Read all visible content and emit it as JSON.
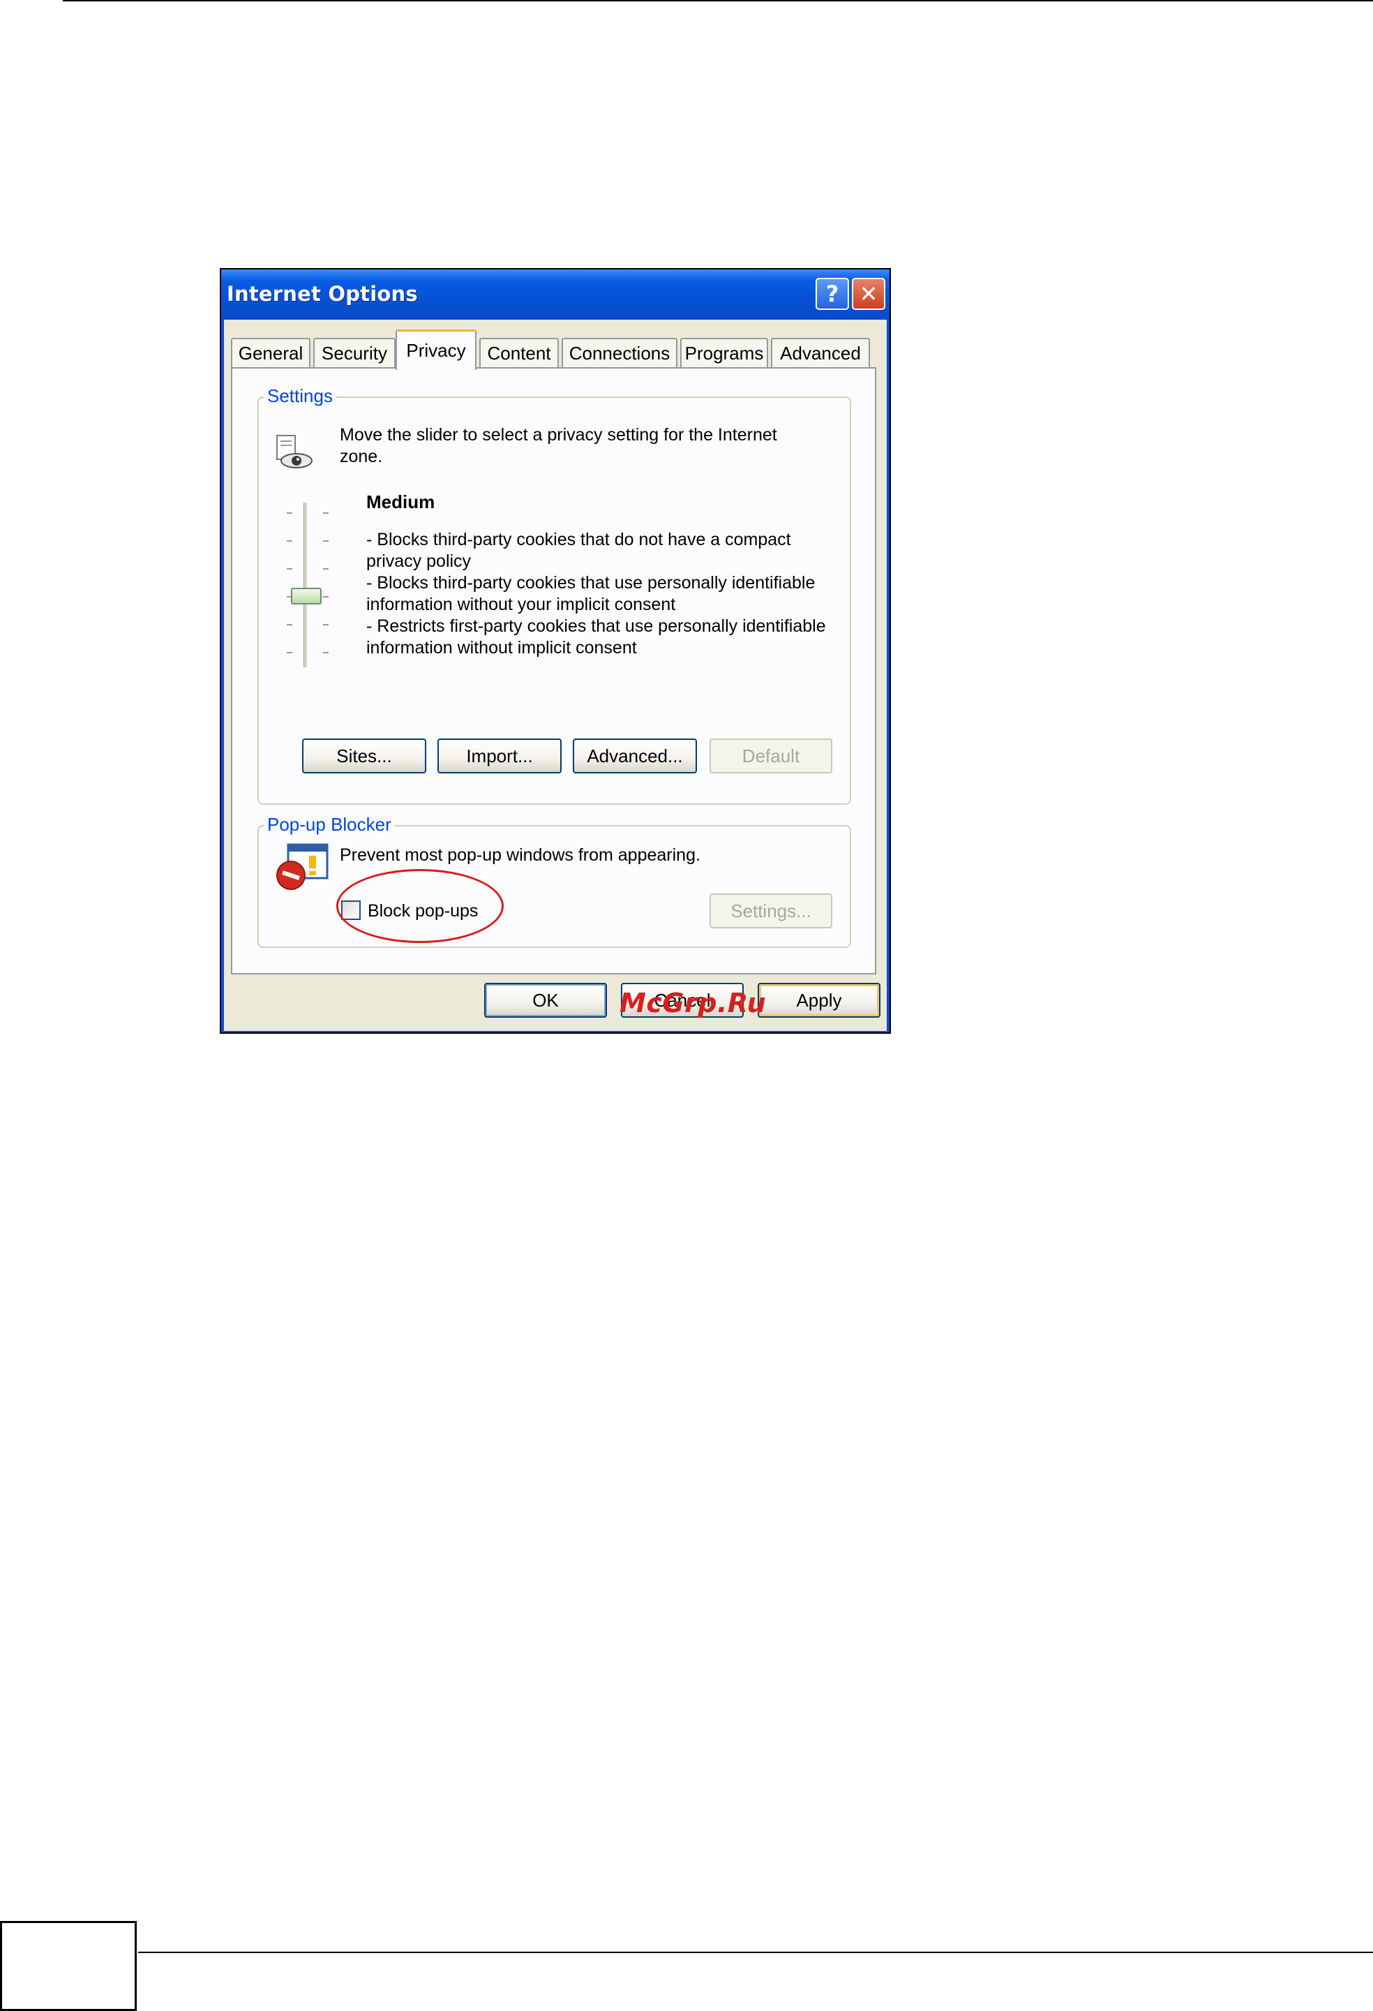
{
  "window": {
    "title": "Internet Options",
    "help_glyph": "?",
    "close_glyph": "✕"
  },
  "tabs": [
    {
      "label": "General",
      "active": false
    },
    {
      "label": "Security",
      "active": false
    },
    {
      "label": "Privacy",
      "active": true
    },
    {
      "label": "Content",
      "active": false
    },
    {
      "label": "Connections",
      "active": false
    },
    {
      "label": "Programs",
      "active": false
    },
    {
      "label": "Advanced",
      "active": false
    }
  ],
  "settings": {
    "group_title": "Settings",
    "icon": "privacy-eye-icon",
    "instruction_line1": "Move the slider to select a privacy setting for the Internet",
    "instruction_line2": "zone.",
    "slider_level": "Medium",
    "description_lines": [
      "- Blocks third-party cookies that do not have a compact",
      "privacy policy",
      "- Blocks third-party cookies that use personally identifiable",
      "information without your implicit consent",
      "- Restricts first-party cookies that use personally identifiable",
      "information without implicit consent"
    ],
    "buttons": {
      "sites": "Sites...",
      "import": "Import...",
      "advanced": "Advanced...",
      "default": "Default"
    }
  },
  "popup_blocker": {
    "group_title": "Pop-up Blocker",
    "icon": "popup-blocked-icon",
    "description": "Prevent most pop-up windows from appearing.",
    "checkbox_label": "Block pop-ups",
    "checkbox_checked": false,
    "settings_button": "Settings..."
  },
  "dialog_buttons": {
    "ok": "OK",
    "cancel": "Cancel",
    "apply": "Apply"
  },
  "watermark": "McGrp.Ru",
  "colors": {
    "title_bar": "#0a5ce3",
    "group_title": "#0046d5",
    "annotation": "#d81c1c",
    "active_tab_accent": "#f0b53b"
  }
}
